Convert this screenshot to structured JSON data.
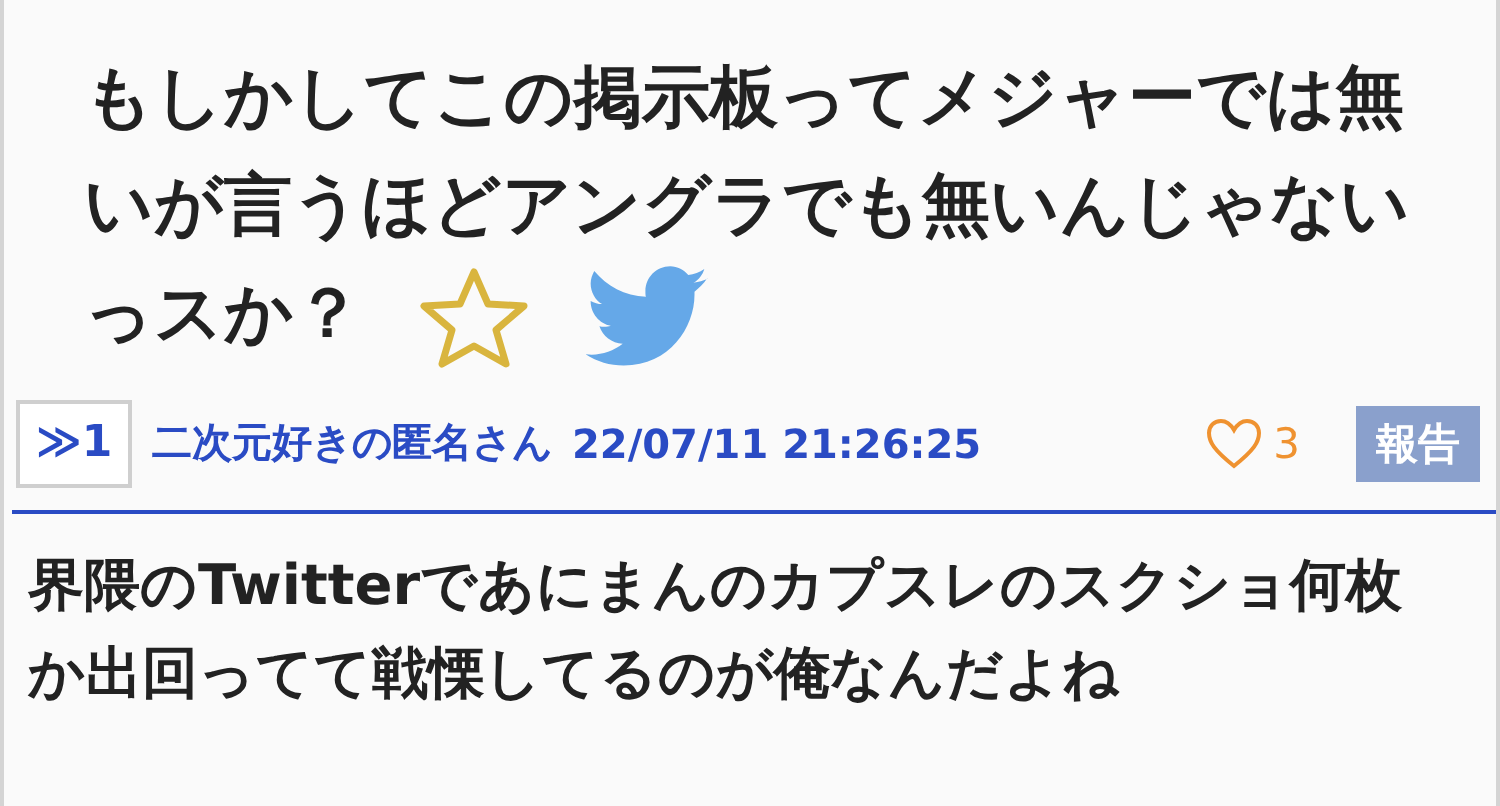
{
  "thread": {
    "title": "もしかしてこの掲示板ってメジャーでは無いが言うほどアングラでも無いんじゃないっスか？",
    "favorited": false
  },
  "post": {
    "number": "≫1",
    "author": "二次元好きの匿名さん",
    "date": "22/07/11 21:26:25",
    "likes": "3",
    "liked": false,
    "report": "報告",
    "body": "界隈のTwitterであにまんのカプスレのスクショ何枚か出回ってて戦慄してるのが俺なんだよね"
  }
}
